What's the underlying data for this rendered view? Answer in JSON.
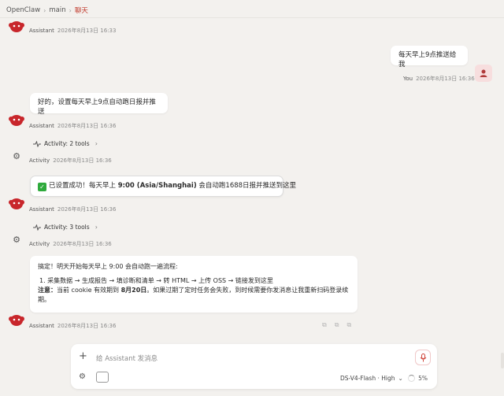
{
  "breadcrumb": {
    "items": [
      "OpenClaw",
      "main",
      "聊天"
    ],
    "sep": "›"
  },
  "messages": {
    "m0": {
      "who": "Assistant",
      "time": "2026年8月13日 16:33"
    },
    "m1": {
      "who": "You",
      "time": "2026年8月13日 16:36",
      "text": "每天早上9点推送给我"
    },
    "m2": {
      "who": "Assistant",
      "time": "2026年8月13日 16:36",
      "text": "好的，设置每天早上9点自动跑日报并推送"
    },
    "a1": {
      "who": "Activity",
      "time": "2026年8月13日 16:36",
      "label": "Activity: 2 tools"
    },
    "m3": {
      "who": "Assistant",
      "time": "2026年8月13日 16:36",
      "text_pre": "已设置成功！每天早上 ",
      "text_bold": "9:00 (Asia/Shanghai)",
      "text_post": " 会自动跑1688日报并推送到这里"
    },
    "a2": {
      "who": "Activity",
      "time": "2026年8月13日 16:36",
      "label": "Activity: 3 tools"
    },
    "m4": {
      "who": "Assistant",
      "time": "2026年8月13日 16:36",
      "line1": "搞定！明天开始每天早上 9:00 会自动跑一遍流程:",
      "line2": "1. 采集数据 → 生成报告 → 填诊断和清单 → 转 HTML → 上传 OSS → 链接发到这里",
      "note_label": "注意：",
      "note_pre": "当前 cookie 有效期到 ",
      "note_bold": "8月20日",
      "note_post": "。如果过期了定时任务会失败，到时候需要你发消息让我重新扫码登录续期。"
    }
  },
  "composer": {
    "placeholder": "给 Assistant 发消息",
    "model": "DS-V4-Flash · High",
    "model_chev": "⌄",
    "context_pct": "5%"
  },
  "colors": {
    "accent": "#c0392b",
    "success": "#2faa3c",
    "bot_red": "#c8262b"
  },
  "icons": [
    "bot-avatar-icon",
    "user-avatar-icon",
    "gear-icon",
    "activity-pulse-icon",
    "plus-icon",
    "mic-icon",
    "panel-icon",
    "copy-icon"
  ]
}
